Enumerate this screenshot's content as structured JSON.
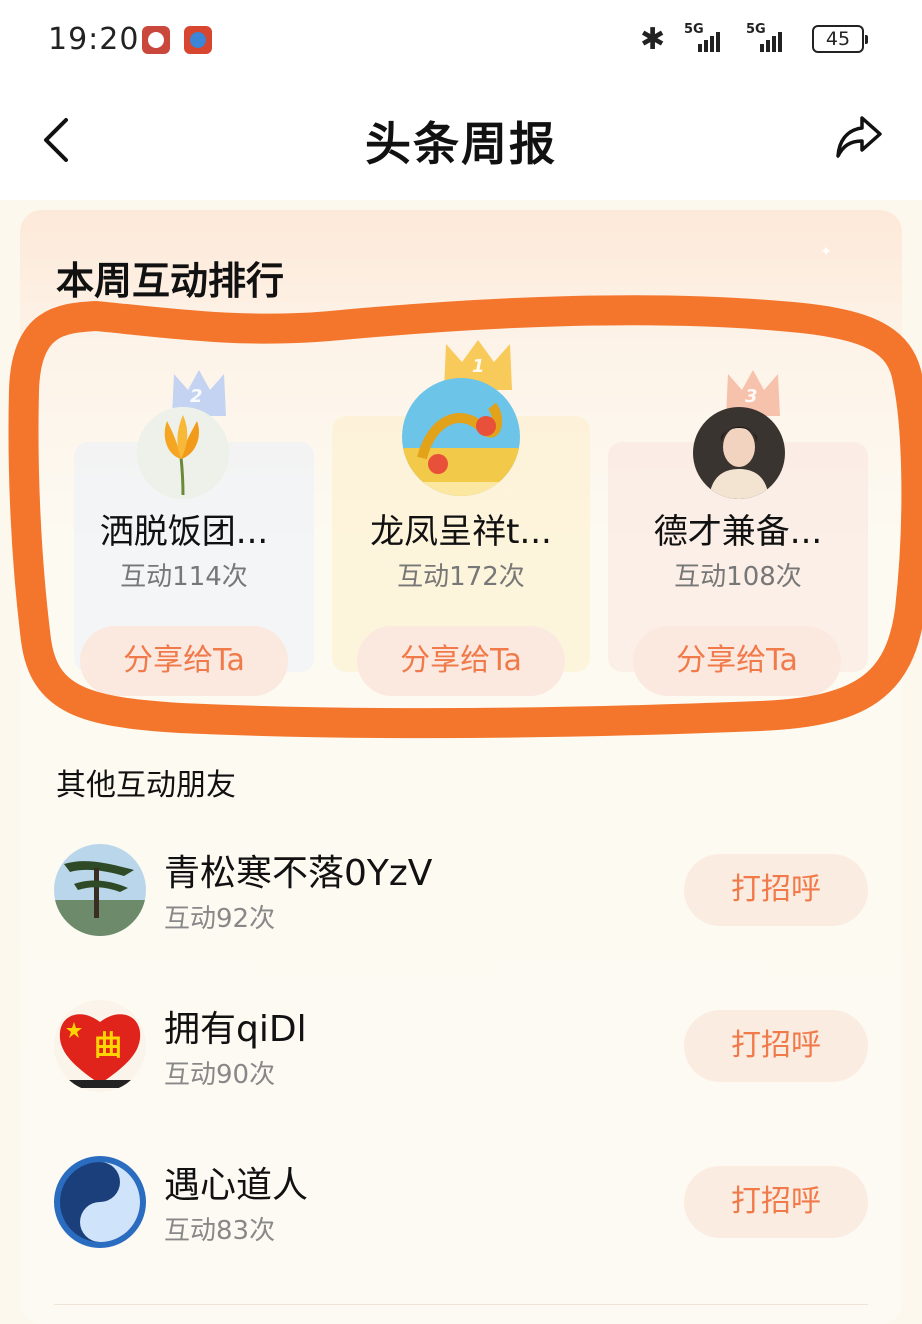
{
  "status_bar": {
    "time": "19:20",
    "signal1_label": "5G",
    "signal2_label": "5G",
    "battery": "45",
    "icons": [
      "app-icon",
      "app-icon",
      "bluetooth-icon",
      "signal-icon",
      "signal-icon",
      "battery-icon"
    ]
  },
  "header": {
    "title": "头条周报",
    "back_icon": "chevron-left-icon",
    "share_icon": "share-icon"
  },
  "ranking": {
    "title": "本周互动排行",
    "podium": [
      {
        "rank": "2",
        "name": "洒脱饭团...",
        "count": "互动114次",
        "button": "分享给Ta"
      },
      {
        "rank": "1",
        "name": "龙凤呈祥t...",
        "count": "互动172次",
        "button": "分享给Ta"
      },
      {
        "rank": "3",
        "name": "德才兼备...",
        "count": "互动108次",
        "button": "分享给Ta"
      }
    ]
  },
  "others": {
    "title": "其他互动朋友",
    "items": [
      {
        "name": "青松寒不落0YzV",
        "count": "互动92次",
        "button": "打招呼"
      },
      {
        "name": "拥有qiDl",
        "count": "互动90次",
        "button": "打招呼",
        "avatar_text": "曲"
      },
      {
        "name": "遇心道人",
        "count": "互动83次",
        "button": "打招呼"
      }
    ]
  },
  "colors": {
    "accent": "#f07a4a",
    "annotation": "#f4752c",
    "crown_gold": "#f7c54a",
    "crown_silver": "#b9cdf2",
    "crown_bronze": "#f6b9a0"
  }
}
